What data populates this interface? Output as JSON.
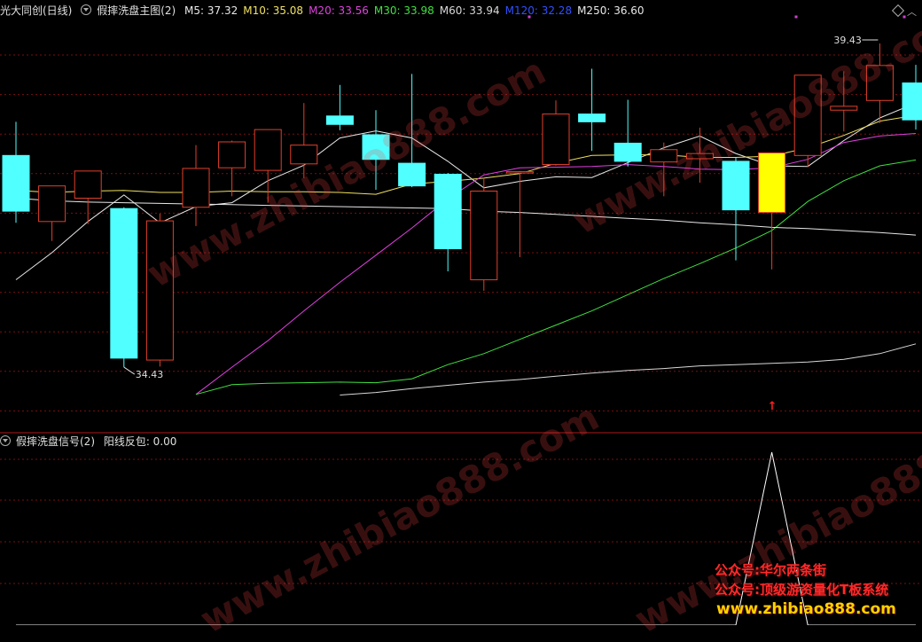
{
  "header": {
    "stock_name": "光大同创(日线)",
    "indicator_main": "假摔洗盘主图(2)",
    "ma_labels": [
      {
        "text": "M5: 37.32",
        "color": "#e8e8e8"
      },
      {
        "text": "M10: 35.08",
        "color": "#f0e060"
      },
      {
        "text": "M20: 33.56",
        "color": "#e040e0"
      },
      {
        "text": "M30: 33.98",
        "color": "#40e040"
      },
      {
        "text": "M60: 33.94",
        "color": "#d8d8d8"
      },
      {
        "text": "M120: 32.28",
        "color": "#3050ff"
      },
      {
        "text": "M250: 36.60",
        "color": "#e8e8e8"
      }
    ]
  },
  "sub_header": {
    "indicator_sub": "假摔洗盘信号(2)",
    "signal_label": "阳线反包: 0.00"
  },
  "chart_data": [
    {
      "type": "candlestick",
      "title": "假摔洗盘主图(2)",
      "ylim": [
        33.5,
        39.8
      ],
      "annotations": [
        {
          "text": "39.43",
          "label": "high"
        },
        {
          "text": "34.43",
          "label": "low"
        }
      ],
      "candles": [
        {
          "o": 37.7,
          "h": 38.22,
          "l": 36.66,
          "c": 36.84
        },
        {
          "o": 36.68,
          "h": 37.1,
          "l": 36.38,
          "c": 37.23
        },
        {
          "o": 37.04,
          "h": 37.45,
          "l": 36.64,
          "c": 37.46
        },
        {
          "o": 36.88,
          "h": 36.9,
          "l": 34.43,
          "c": 34.57
        },
        {
          "o": 34.54,
          "h": 36.8,
          "l": 34.44,
          "c": 36.69
        },
        {
          "o": 36.9,
          "h": 37.86,
          "l": 36.61,
          "c": 37.5
        },
        {
          "o": 37.51,
          "h": 37.93,
          "l": 37.07,
          "c": 37.91
        },
        {
          "o": 37.47,
          "h": 38.03,
          "l": 36.97,
          "c": 38.1
        },
        {
          "o": 37.57,
          "h": 38.51,
          "l": 37.35,
          "c": 37.86
        },
        {
          "o": 38.31,
          "h": 38.79,
          "l": 38.09,
          "c": 38.18
        },
        {
          "o": 38.02,
          "h": 38.4,
          "l": 37.17,
          "c": 37.64
        },
        {
          "o": 37.58,
          "h": 38.96,
          "l": 37.21,
          "c": 37.23
        },
        {
          "o": 37.41,
          "h": 37.43,
          "l": 35.91,
          "c": 36.26
        },
        {
          "o": 35.78,
          "h": 37.35,
          "l": 35.61,
          "c": 37.15
        },
        {
          "o": 37.45,
          "h": 37.46,
          "l": 36.13,
          "c": 37.45
        },
        {
          "o": 37.56,
          "h": 38.55,
          "l": 37.54,
          "c": 38.34
        },
        {
          "o": 38.34,
          "h": 39.04,
          "l": 37.77,
          "c": 38.22
        },
        {
          "o": 37.89,
          "h": 38.56,
          "l": 37.53,
          "c": 37.61
        },
        {
          "o": 37.6,
          "h": 37.9,
          "l": 37.07,
          "c": 37.79
        },
        {
          "o": 37.65,
          "h": 38.13,
          "l": 37.28,
          "c": 37.73
        },
        {
          "o": 37.61,
          "h": 37.67,
          "l": 36.08,
          "c": 36.86
        },
        {
          "o": 36.82,
          "h": 37.65,
          "l": 35.94,
          "c": 37.74
        },
        {
          "o": 37.7,
          "h": 38.94,
          "l": 37.52,
          "c": 38.94
        },
        {
          "o": 38.4,
          "h": 39.0,
          "l": 38.07,
          "c": 38.46
        },
        {
          "o": 38.55,
          "h": 39.43,
          "l": 38.2,
          "c": 39.09
        },
        {
          "o": 38.82,
          "h": 39.1,
          "l": 38.1,
          "c": 38.25
        }
      ],
      "highlight_index": 21,
      "signal_arrow_index": 21,
      "ma_lines": [
        {
          "name": "M5",
          "color": "#e8e8e8",
          "start": 0,
          "values": [
            35.78,
            36.2,
            36.68,
            37.09,
            36.66,
            36.91,
            36.97,
            37.31,
            37.55,
            37.97,
            38.08,
            37.97,
            37.61,
            37.2,
            37.3,
            37.37,
            37.36,
            37.59,
            37.82,
            38.0,
            37.73,
            37.54,
            37.53,
            37.93,
            38.28,
            38.51
          ]
        },
        {
          "name": "M10",
          "color": "#f0e060",
          "start": 0,
          "values": [
            37.16,
            37.13,
            37.15,
            37.16,
            37.13,
            37.13,
            37.15,
            37.14,
            37.14,
            37.13,
            37.1,
            37.26,
            37.3,
            37.35,
            37.42,
            37.58,
            37.7,
            37.71,
            37.71,
            37.67,
            37.67,
            37.69,
            37.82,
            38.01,
            38.23,
            38.32
          ]
        },
        {
          "name": "M20",
          "color": "#e040e0",
          "start": 5,
          "values": [
            34.01,
            34.43,
            34.84,
            35.3,
            35.74,
            36.16,
            36.58,
            37.03,
            37.4,
            37.51,
            37.52,
            37.53,
            37.56,
            37.53,
            37.49,
            37.48,
            37.51,
            37.64,
            37.9,
            38.0,
            38.04
          ]
        },
        {
          "name": "M30",
          "color": "#40e040",
          "start": 5,
          "values": [
            34.01,
            34.16,
            34.18,
            34.19,
            34.2,
            34.19,
            34.25,
            34.47,
            34.64,
            34.86,
            35.08,
            35.3,
            35.55,
            35.8,
            36.03,
            36.27,
            36.54,
            36.99,
            37.31,
            37.54,
            37.63
          ]
        },
        {
          "name": "M60",
          "color": "#d8d8d8",
          "start": 9,
          "values": [
            34.0,
            34.04,
            34.1,
            34.15,
            34.2,
            34.24,
            34.29,
            34.34,
            34.38,
            34.41,
            34.45,
            34.47,
            34.49,
            34.51,
            34.55,
            34.64,
            34.79
          ]
        },
        {
          "name": "M250",
          "color": "#e8e8e8",
          "start": 0,
          "values": [
            37.04,
            37.0,
            36.98,
            36.97,
            36.96,
            36.95,
            36.94,
            36.93,
            36.92,
            36.91,
            36.9,
            36.89,
            36.88,
            36.84,
            36.82,
            36.79,
            36.76,
            36.73,
            36.7,
            36.66,
            36.63,
            36.59,
            36.57,
            36.54,
            36.51,
            36.47
          ]
        }
      ]
    },
    {
      "type": "line",
      "title": "假摔洗盘信号(2)",
      "series": [
        {
          "name": "阳线反包",
          "color": "#ffffff",
          "values": [
            0,
            0,
            0,
            0,
            0,
            0,
            0,
            0,
            0,
            0,
            0,
            0,
            0,
            0,
            0,
            0,
            0,
            0,
            0,
            0,
            0,
            1,
            0,
            0,
            0,
            0
          ]
        }
      ],
      "ylim": [
        0,
        1
      ]
    }
  ],
  "watermarks": {
    "line1": "公众号:华尔两条街",
    "line2": "公众号:顶级游资量化T板系统",
    "line3": "www.zhibiao888.com",
    "bg_text": "www.zhibiao888.com"
  }
}
